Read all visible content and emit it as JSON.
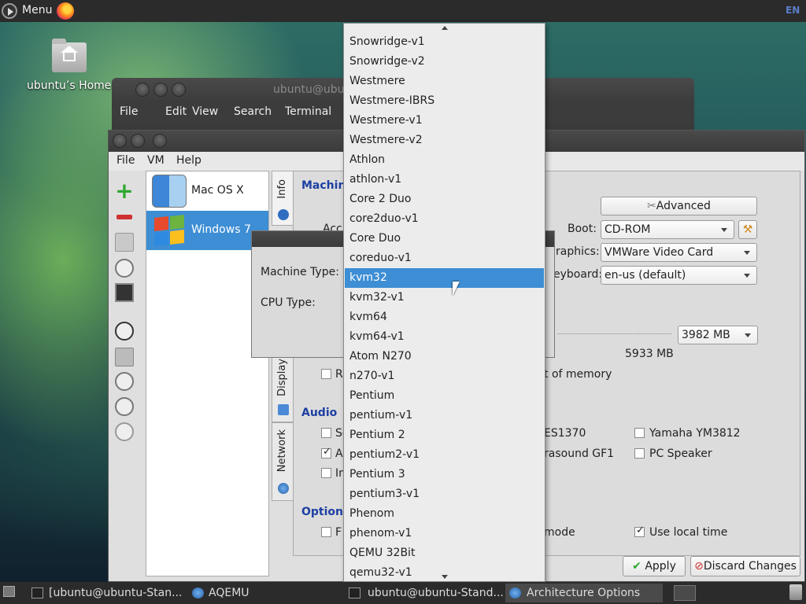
{
  "top_panel": {
    "menu_label": "Menu",
    "keyboard_layout": "EN"
  },
  "desktop": {
    "home_label": "ubuntu’s Home"
  },
  "terminal": {
    "title": "ubuntu@ubu",
    "menu": [
      "File",
      "Edit",
      "View",
      "Search",
      "Terminal"
    ]
  },
  "aqemu": {
    "menu": {
      "file": "File",
      "vm": "VM",
      "help": "Help"
    },
    "vms": [
      {
        "name": "Mac OS X"
      },
      {
        "name": "Windows 7"
      }
    ],
    "tabs": {
      "info": "Info",
      "display": "Display",
      "network": "Network"
    },
    "machine_section": "Machin",
    "advanced_label": "Advanced",
    "acc_partial": "Acc",
    "boot_label": "Boot:",
    "boot_value": "CD-ROM",
    "graphics_label": "raphics:",
    "graphics_value": "VMWare Video Card",
    "keyboard_label": "eyboard:",
    "keyboard_value": "en-us (default)",
    "memory_value": "3982 MB",
    "memory_max": "5933 MB",
    "memory_partial_label": "t of memory",
    "r_partial": "R",
    "audio_section": "Audio",
    "audio_partials": [
      "Sc",
      "A",
      "In"
    ],
    "audio_es1370": "ES1370",
    "audio_ultrasound": "rasound GF1",
    "audio_yamaha": "Yamaha YM3812",
    "audio_pcspeaker": "PC Speaker",
    "options_section": "Options",
    "options_partial": "F",
    "mode_partial": "mode",
    "use_local_time": "Use local time",
    "apply_label": "Apply",
    "discard_label": "Discard Changes"
  },
  "dialog": {
    "machine_type_label": "Machine Type:",
    "cpu_type_label": "CPU Type:"
  },
  "cpu_dropdown": {
    "selected": "kvm32",
    "options": [
      "Snowridge-v1",
      "Snowridge-v2",
      "Westmere",
      "Westmere-IBRS",
      "Westmere-v1",
      "Westmere-v2",
      "Athlon",
      "athlon-v1",
      "Core 2 Duo",
      "core2duo-v1",
      "Core Duo",
      "coreduo-v1",
      "kvm32",
      "kvm32-v1",
      "kvm64",
      "kvm64-v1",
      "Atom N270",
      "n270-v1",
      "Pentium",
      "pentium-v1",
      "Pentium 2",
      "pentium2-v1",
      "Pentium 3",
      "pentium3-v1",
      "Phenom",
      "phenom-v1",
      "QEMU 32Bit",
      "qemu32-v1"
    ]
  },
  "taskbar": {
    "tasks": [
      {
        "label": "[ubuntu@ubuntu-Stan...",
        "active": false
      },
      {
        "label": "AQEMU",
        "active": false
      },
      {
        "label": "ubuntu@ubuntu-Stand...",
        "active": false
      },
      {
        "label": "Architecture Options",
        "active": true
      }
    ]
  }
}
